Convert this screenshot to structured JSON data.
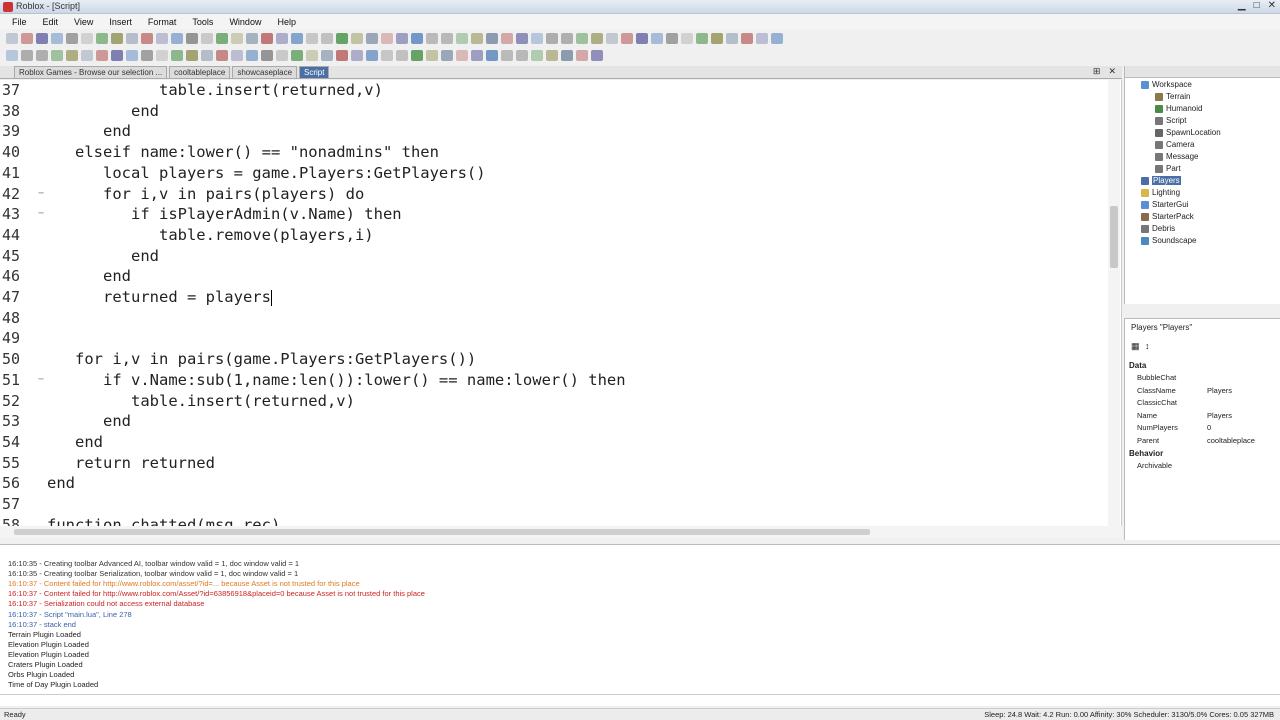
{
  "window": {
    "title": "Roblox - [Script]"
  },
  "menu": [
    "File",
    "Edit",
    "View",
    "Insert",
    "Format",
    "Tools",
    "Window",
    "Help"
  ],
  "tabs": [
    "Roblox Games - Browse our selection ...",
    "cooltableplace",
    "showcaseplace",
    "Script"
  ],
  "editor": {
    "lines": [
      {
        "n": "37",
        "fold": "",
        "text": "            table.insert(returned,v)"
      },
      {
        "n": "38",
        "fold": "",
        "text": "         end"
      },
      {
        "n": "39",
        "fold": "",
        "text": "      end"
      },
      {
        "n": "40",
        "fold": "",
        "text": "   elseif name:lower() == \"nonadmins\" then"
      },
      {
        "n": "41",
        "fold": "",
        "text": "      local players = game.Players:GetPlayers()"
      },
      {
        "n": "42",
        "fold": "−",
        "text": "      for i,v in pairs(players) do"
      },
      {
        "n": "43",
        "fold": "−",
        "text": "         if isPlayerAdmin(v.Name) then"
      },
      {
        "n": "44",
        "fold": "",
        "text": "            table.remove(players,i)"
      },
      {
        "n": "45",
        "fold": "",
        "text": "         end"
      },
      {
        "n": "46",
        "fold": "",
        "text": "      end"
      },
      {
        "n": "47",
        "fold": "",
        "text": "      returned = players"
      },
      {
        "n": "48",
        "fold": "",
        "text": ""
      },
      {
        "n": "49",
        "fold": "",
        "text": ""
      },
      {
        "n": "50",
        "fold": "",
        "text": "   for i,v in pairs(game.Players:GetPlayers())"
      },
      {
        "n": "51",
        "fold": "−",
        "text": "      if v.Name:sub(1,name:len()):lower() == name:lower() then"
      },
      {
        "n": "52",
        "fold": "",
        "text": "         table.insert(returned,v)"
      },
      {
        "n": "53",
        "fold": "",
        "text": "      end"
      },
      {
        "n": "54",
        "fold": "",
        "text": "   end"
      },
      {
        "n": "55",
        "fold": "",
        "text": "   return returned"
      },
      {
        "n": "56",
        "fold": "",
        "text": "end"
      },
      {
        "n": "57",
        "fold": "",
        "text": ""
      },
      {
        "n": "58",
        "fold": "",
        "text": "function chatted(msg,rec)"
      }
    ]
  },
  "explorer": {
    "items": [
      {
        "label": "Workspace",
        "color": "#5b8fd1",
        "selected": false
      },
      {
        "label": "Terrain",
        "color": "#8a7a4a",
        "selected": false
      },
      {
        "label": "Humanoid",
        "color": "#4a8a4a",
        "selected": false
      },
      {
        "label": "Script",
        "color": "#777777",
        "selected": false
      },
      {
        "label": "SpawnLocation",
        "color": "#666666",
        "selected": false
      },
      {
        "label": "Camera",
        "color": "#777777",
        "selected": false
      },
      {
        "label": "Message",
        "color": "#777777",
        "selected": false
      },
      {
        "label": "Part",
        "color": "#777777",
        "selected": false
      },
      {
        "label": "Players",
        "color": "#4a6fa5",
        "selected": true
      },
      {
        "label": "Lighting",
        "color": "#d8b84a",
        "selected": false
      },
      {
        "label": "StarterGui",
        "color": "#5b8fd1",
        "selected": false
      },
      {
        "label": "StarterPack",
        "color": "#8a6a4a",
        "selected": false
      },
      {
        "label": "Debris",
        "color": "#777777",
        "selected": false
      },
      {
        "label": "Soundscape",
        "color": "#4a8ac0",
        "selected": false
      }
    ]
  },
  "properties": {
    "title": "Players \"Players\"",
    "section_data": "Data",
    "section_behavior": "Behavior",
    "rows": [
      {
        "name": "BubbleChat",
        "value": ""
      },
      {
        "name": "ClassName",
        "value": "Players"
      },
      {
        "name": "ClassicChat",
        "value": ""
      },
      {
        "name": "Name",
        "value": "Players"
      },
      {
        "name": "NumPlayers",
        "value": "0"
      },
      {
        "name": "Parent",
        "value": "cooltableplace"
      }
    ],
    "behavior_rows": [
      {
        "name": "Archivable",
        "value": ""
      }
    ]
  },
  "output": {
    "lines": [
      {
        "text": "16:10:35 - Creating toolbar Advanced AI, toolbar window valid = 1, doc window valid = 1",
        "color": "#333333"
      },
      {
        "text": "16:10:35 - Creating toolbar Serialization, toolbar window valid = 1, doc window valid = 1",
        "color": "#333333"
      },
      {
        "text": "16:10:37 - Content failed for http://www.roblox.com/asset/?id=... because Asset is not trusted for this place",
        "color": "#e07a20"
      },
      {
        "text": "16:10:37 - Content failed for http://www.roblox.com/Asset/?id=63856918&placeid=0 because Asset is not trusted for this place",
        "color": "#cc2222"
      },
      {
        "text": "16:10:37 - Serialization could not access external database",
        "color": "#cc2222"
      },
      {
        "text": "16:10:37 - Script \"main.lua\", Line 278",
        "color": "#3a5faa"
      },
      {
        "text": "16:10:37 - stack end",
        "color": "#3a5faa"
      },
      {
        "text": "Terrain Plugin Loaded",
        "color": "#222222"
      },
      {
        "text": "Elevation Plugin Loaded",
        "color": "#222222"
      },
      {
        "text": "Elevation Plugin Loaded",
        "color": "#222222"
      },
      {
        "text": "Craters Plugin Loaded",
        "color": "#222222"
      },
      {
        "text": "Orbs Plugin Loaded",
        "color": "#222222"
      },
      {
        "text": "Time of Day Plugin Loaded",
        "color": "#222222"
      }
    ]
  },
  "status": {
    "left": "Ready",
    "right": "Sleep: 24.8  Wait: 4.2  Run: 0.00  Affinity: 30%  Scheduler: 3130/5.0%      Cores: 0.05   327MB"
  }
}
